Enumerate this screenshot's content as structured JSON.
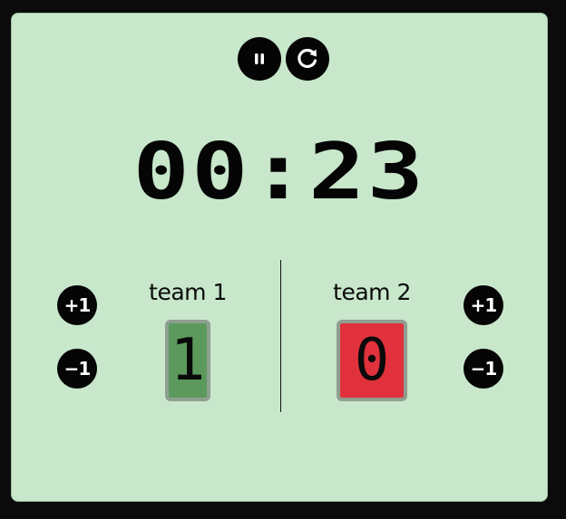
{
  "colors": {
    "background": "#c8e7cb",
    "button": "#050505",
    "team1_score_bg": "#5b9a5c",
    "team2_score_bg": "#e0313c"
  },
  "controls": {
    "pause_icon": "pause-icon",
    "reset_icon": "reset-icon"
  },
  "timer": {
    "display": "00:23"
  },
  "team1": {
    "name": "team 1",
    "score": "1",
    "plus_label": "+1",
    "minus_label": "−1"
  },
  "team2": {
    "name": "team 2",
    "score": "0",
    "plus_label": "+1",
    "minus_label": "−1"
  }
}
